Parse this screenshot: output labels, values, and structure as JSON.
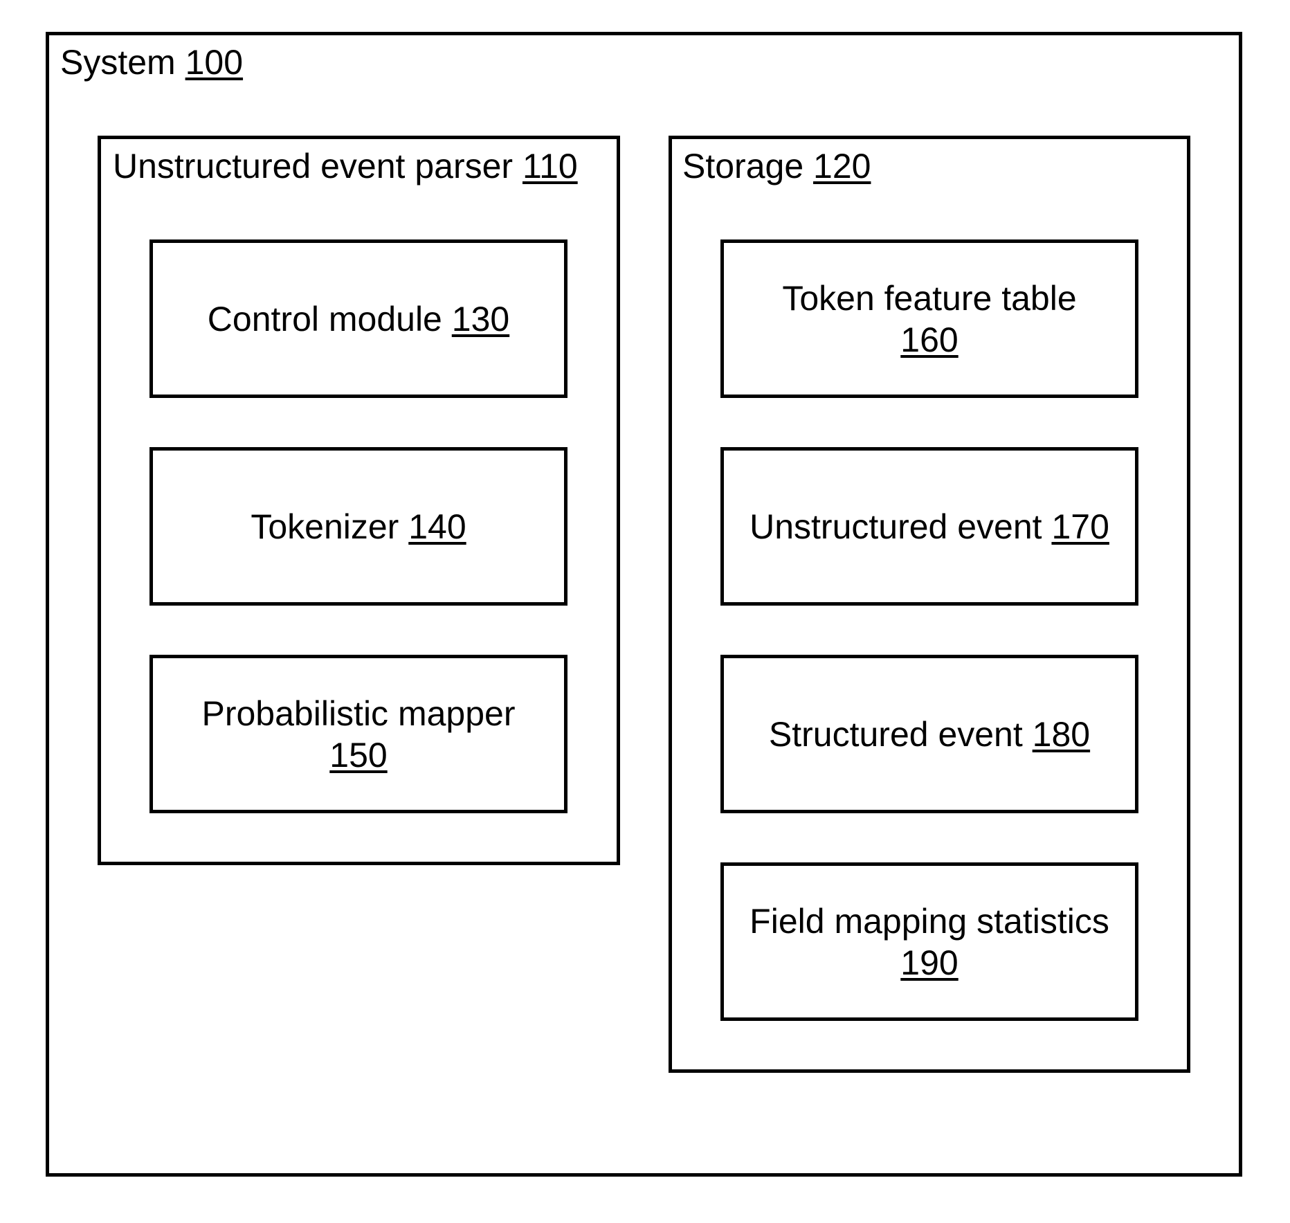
{
  "system": {
    "label": "System",
    "ref": "100"
  },
  "parser": {
    "label": "Unstructured event parser",
    "ref": "110",
    "components": [
      {
        "label": "Control module",
        "ref": "130"
      },
      {
        "label": "Tokenizer",
        "ref": "140"
      },
      {
        "label": "Probabilistic mapper",
        "ref": "150"
      }
    ]
  },
  "storage": {
    "label": "Storage",
    "ref": "120",
    "components": [
      {
        "label": "Token feature table",
        "ref": "160"
      },
      {
        "label": "Unstructured event",
        "ref": "170"
      },
      {
        "label": "Structured event",
        "ref": "180"
      },
      {
        "label": "Field mapping statistics",
        "ref": "190"
      }
    ]
  }
}
